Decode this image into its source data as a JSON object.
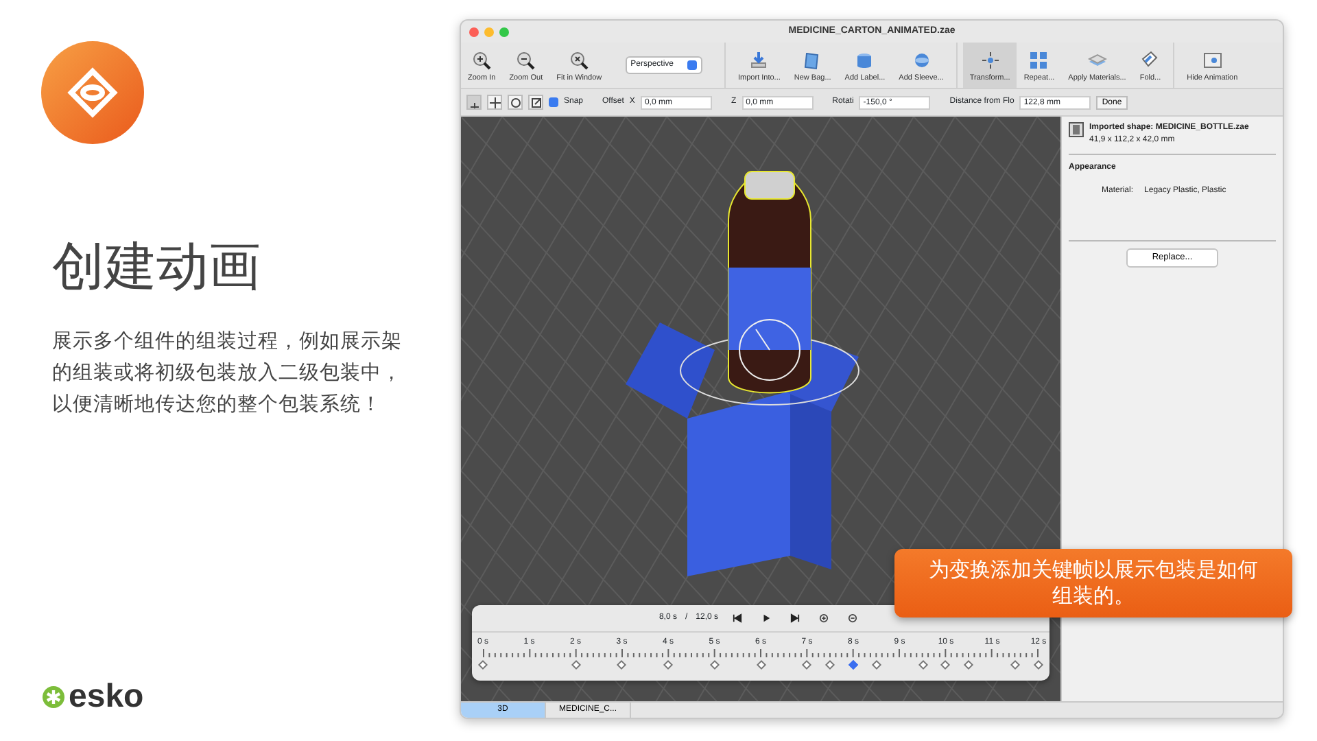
{
  "slide": {
    "title": "创建动画",
    "body": "展示多个组件的组装过程，例如展示架的组装或将初级包装放入二级包装中，以便清晰地传达您的整个包装系统！",
    "brand": "esko"
  },
  "window": {
    "title": "MEDICINE_CARTON_ANIMATED.zae"
  },
  "toolbar": [
    {
      "label": "Zoom In",
      "selected": false
    },
    {
      "label": "Zoom Out",
      "selected": false
    },
    {
      "label": "Fit in Window",
      "selected": false
    }
  ],
  "view_select": {
    "value": "Perspective"
  },
  "toolbar_right": [
    {
      "label": "Import Into...",
      "selected": false
    },
    {
      "label": "New Bag...",
      "selected": false
    },
    {
      "label": "Add Label...",
      "selected": false
    },
    {
      "label": "Add Sleeve...",
      "selected": false
    },
    {
      "label": "Transform...",
      "selected": true
    },
    {
      "label": "Repeat...",
      "selected": false
    },
    {
      "label": "Apply Materials...",
      "selected": false
    },
    {
      "label": "Fold...",
      "selected": false
    },
    {
      "label": "Hide Animation",
      "selected": false
    }
  ],
  "transform_bar": {
    "modes": [
      {
        "selected": true
      },
      {
        "selected": false
      },
      {
        "selected": false
      },
      {
        "selected": false
      }
    ],
    "snap": {
      "label": "Snap",
      "checked": true
    },
    "fields": [
      {
        "label": "Offset",
        "axis": "X",
        "value": "0,0 mm"
      },
      {
        "axis": "Z",
        "value": "0,0 mm"
      },
      {
        "label": "Rotati",
        "value": "-150,0 °"
      },
      {
        "label": "Distance from Flo",
        "value": "122,8 mm"
      }
    ],
    "done": "Done"
  },
  "inspector": {
    "shape": "Imported shape: MEDICINE_BOTTLE.zae",
    "size": "41,9 x 112,2 x 42,0 mm",
    "section": "Appearance",
    "material_label": "Material:",
    "material": "Legacy Plastic, Plastic",
    "button": "Replace..."
  },
  "timeline": {
    "current": "8,0 s",
    "separator": "/",
    "total": "12,0 s",
    "ticks": [
      "0 s",
      "1 s",
      "2 s",
      "3 s",
      "4 s",
      "5 s",
      "6 s",
      "7 s",
      "8 s",
      "9 s",
      "10 s",
      "11 s",
      "12 s"
    ],
    "keyframes": [
      {
        "level": 0,
        "selected": false
      },
      {
        "level": 0.1667,
        "selected": false
      },
      {
        "level": 0.25,
        "selected": false
      },
      {
        "level": 0.3333,
        "selected": false
      },
      {
        "level": 0.4167,
        "selected": false
      },
      {
        "level": 0.5,
        "selected": false
      },
      {
        "level": 0.5833,
        "selected": false
      },
      {
        "level": 0.625,
        "selected": false
      },
      {
        "level": 0.6667,
        "selected": true
      },
      {
        "level": 0.7083,
        "selected": false
      },
      {
        "level": 0.7917,
        "selected": false
      },
      {
        "level": 0.8333,
        "selected": false
      },
      {
        "level": 0.875,
        "selected": false
      },
      {
        "level": 0.9583,
        "selected": false
      },
      {
        "level": 1,
        "selected": false
      }
    ]
  },
  "tabs": [
    {
      "label": "3D",
      "selected": true
    },
    {
      "label": "MEDICINE_C...",
      "selected": false
    }
  ],
  "callout": "为变换添加关键帧以展示包装是如何组装的。"
}
